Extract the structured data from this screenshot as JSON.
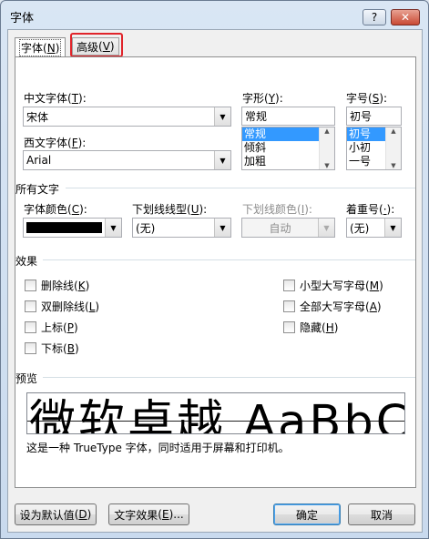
{
  "window": {
    "title": "字体",
    "help_label": "?",
    "close_label": "✕"
  },
  "tabs": [
    {
      "label": "字体",
      "hotkey": "N",
      "selected": true
    },
    {
      "label": "高级",
      "hotkey": "V",
      "selected": false,
      "highlighted": true
    }
  ],
  "font": {
    "chinese_font_label": "中文字体",
    "chinese_font_hotkey": "T",
    "chinese_font_value": "宋体",
    "western_font_label": "西文字体",
    "western_font_hotkey": "F",
    "western_font_value": "Arial",
    "style_label": "字形",
    "style_hotkey": "Y",
    "style_value": "常规",
    "style_options": [
      "常规",
      "倾斜",
      "加粗"
    ],
    "style_selected": "常规",
    "size_label": "字号",
    "size_hotkey": "S",
    "size_value": "初号",
    "size_options": [
      "初号",
      "小初",
      "一号"
    ],
    "size_selected": "初号"
  },
  "all_text": {
    "section_label": "所有文字",
    "font_color_label": "字体颜色",
    "font_color_hotkey": "C",
    "font_color_value": "#000000",
    "underline_style_label": "下划线线型",
    "underline_style_hotkey": "U",
    "underline_style_value": "(无)",
    "underline_color_label": "下划线颜色",
    "underline_color_hotkey": "I",
    "underline_color_value": "自动",
    "emphasis_label": "着重号",
    "emphasis_hotkey": "·",
    "emphasis_value": "(无)"
  },
  "effects": {
    "section_label": "效果",
    "left": [
      {
        "label": "删除线",
        "hotkey": "K",
        "checked": false
      },
      {
        "label": "双删除线",
        "hotkey": "L",
        "checked": false
      },
      {
        "label": "上标",
        "hotkey": "P",
        "checked": false
      },
      {
        "label": "下标",
        "hotkey": "B",
        "checked": false
      }
    ],
    "right": [
      {
        "label": "小型大写字母",
        "hotkey": "M",
        "checked": false
      },
      {
        "label": "全部大写字母",
        "hotkey": "A",
        "checked": false
      },
      {
        "label": "隐藏",
        "hotkey": "H",
        "checked": false
      }
    ]
  },
  "preview": {
    "section_label": "预览",
    "sample_text": "微软卓越  AaBbCc",
    "note": "这是一种 TrueType 字体，同时适用于屏幕和打印机。"
  },
  "buttons": {
    "set_default_label": "设为默认值",
    "set_default_hotkey": "D",
    "text_effects_label": "文字效果",
    "text_effects_hotkey": "E",
    "text_effects_suffix": "...",
    "ok_label": "确定",
    "cancel_label": "取消"
  },
  "colors": {
    "highlight_box": "#e0242a",
    "selection": "#3399ff",
    "accent": "#3c7fb1"
  }
}
